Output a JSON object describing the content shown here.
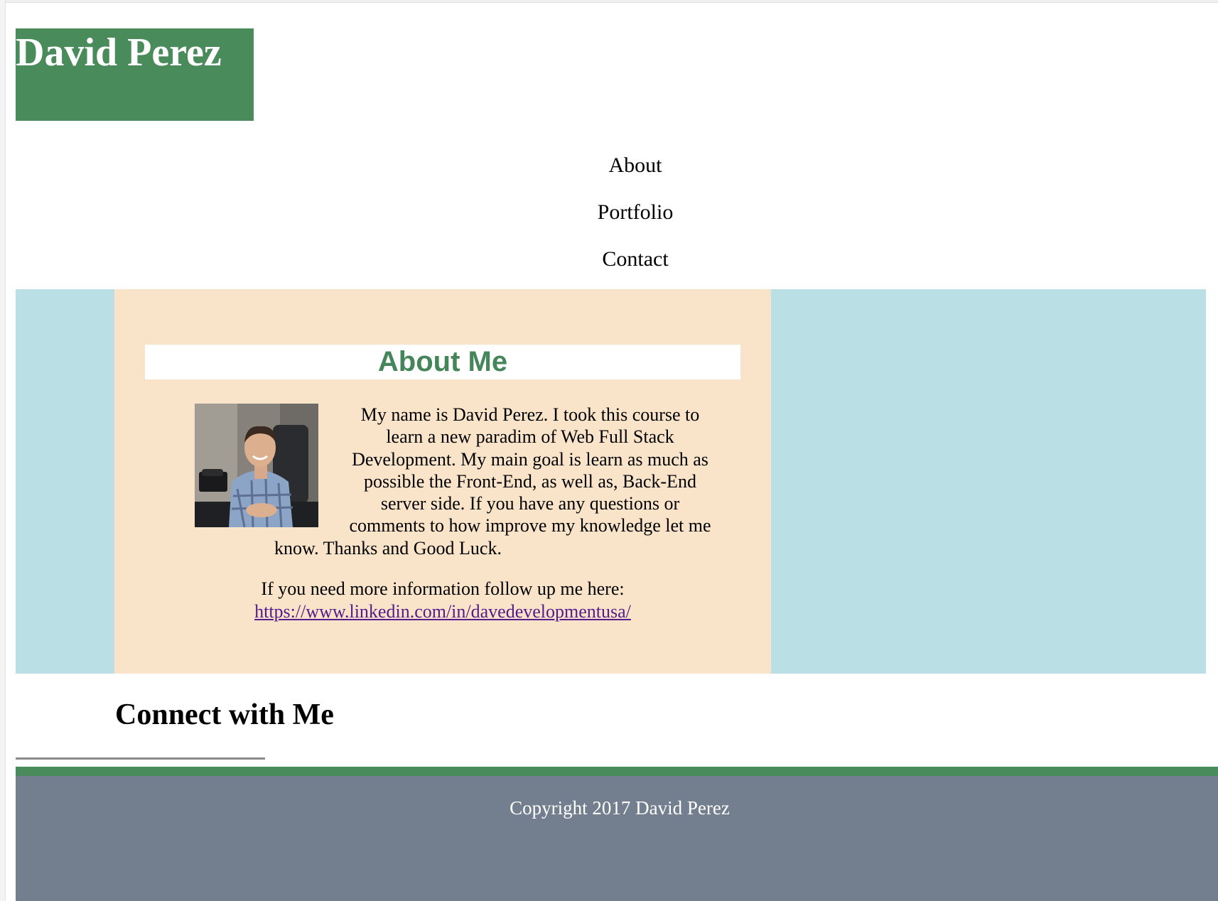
{
  "header": {
    "site_title": "David Perez",
    "brand_color": "#4a8b5c"
  },
  "nav": {
    "items": [
      {
        "label": "About"
      },
      {
        "label": "Portfolio"
      },
      {
        "label": "Contact"
      }
    ]
  },
  "about": {
    "heading": "About Me",
    "heading_color": "#44855a",
    "panel_color": "#f9e4c9",
    "band_color": "#bae0e5",
    "bio_lines": [
      "My name is David Perez. I took this course to",
      "learn a new paradim of Web Full Stack",
      "Development. My main goal is learn as much as",
      "possible the Front-End, as well as, Back-End",
      "server side. If you have any questions or",
      "comments to how improve my knowledge let me",
      "know. Thanks and Good Luck."
    ],
    "followup_text": "If you need more information follow up me here:",
    "linkedin_url": "https://www.linkedin.com/in/davedevelopmentusa/"
  },
  "connect": {
    "heading": "Connect with Me"
  },
  "footer": {
    "copyright": "Copyright 2017 David Perez",
    "background_color": "#737f8f"
  }
}
